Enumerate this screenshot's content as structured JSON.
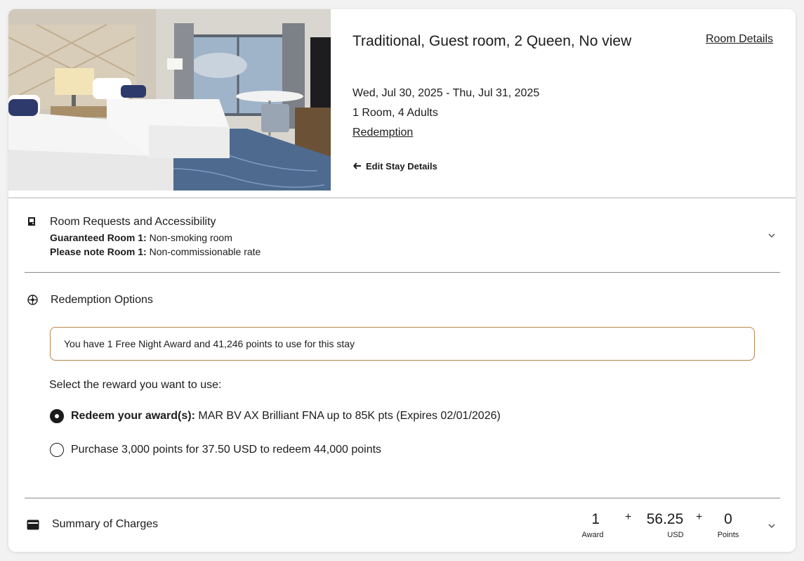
{
  "room": {
    "title": "Traditional, Guest room, 2 Queen, No view",
    "details_link": "Room Details",
    "dates": "Wed, Jul 30, 2025 - Thu, Jul 31, 2025",
    "occupancy": "1 Room, 4 Adults",
    "rate_link": "Redemption",
    "edit_label": "Edit Stay Details"
  },
  "requests": {
    "title": "Room Requests and Accessibility",
    "line1_label": "Guaranteed Room 1:",
    "line1_value": "Non-smoking room",
    "line2_label": "Please note Room 1:",
    "line2_value": "Non-commissionable rate"
  },
  "redemption": {
    "title": "Redemption Options",
    "banner": "You have 1 Free Night Award and 41,246 points to use for this stay",
    "prompt": "Select the reward you want to use:",
    "options": [
      {
        "bold": "Redeem your award(s):",
        "text": "MAR BV AX Brilliant FNA up to 85K pts (Expires 02/01/2026)",
        "selected": true
      },
      {
        "bold": "",
        "text": "Purchase 3,000 points for 37.50 USD to redeem 44,000 points",
        "selected": false
      }
    ]
  },
  "summary": {
    "title": "Summary of Charges",
    "award_value": "1",
    "award_label": "Award",
    "plus": "+",
    "usd_value": "56.25",
    "usd_label": "USD",
    "points_value": "0",
    "points_label": "Points"
  },
  "colors": {
    "banner_border": "#b8864b",
    "text": "#1c1c1c"
  }
}
